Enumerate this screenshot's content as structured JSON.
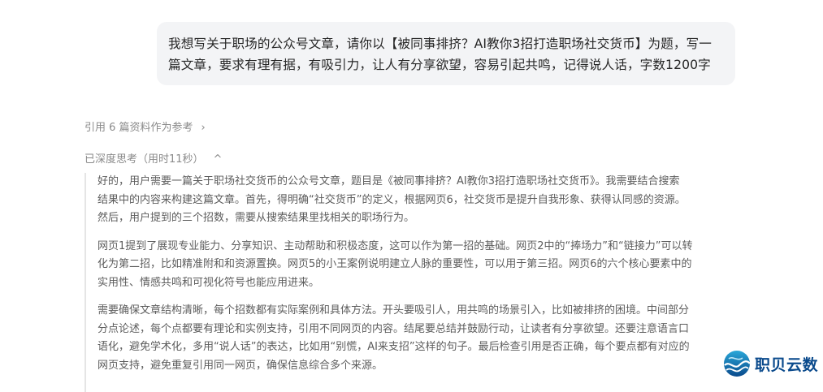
{
  "user_message": {
    "line1": "我想写关于职场的公众号文章，请你以【被同事排挤？AI教你3招打造职场社交货币】为题，写一",
    "line2": "篇文章，要求有理有据，有吸引力，让人有分享欲望，容易引起共鸣，记得说人话，字数1200字"
  },
  "references": {
    "label": "引用 6 篇资料作为参考",
    "chevron": "›"
  },
  "thinking": {
    "label": "已深度思考（用时11秒）",
    "chevron": "^",
    "paragraphs": [
      {
        "lines": [
          "好的，用户需要一篇关于职场社交货币的公众号文章，题目是《被同事排挤？AI教你3招打造职场社交货币》。我需要结合搜索",
          "结果中的内容来构建这篇文章。首先，得明确“社交货币”的定义，根据网页6，社交货币是提升自我形象、获得认同感的资源。",
          "然后，用户提到的三个招数，需要从搜索结果里找相关的职场行为。"
        ]
      },
      {
        "lines": [
          "网页1提到了展现专业能力、分享知识、主动帮助和积极态度，这可以作为第一招的基础。网页2中的“捧场力”和“链接力”可以转",
          "化为第二招，比如精准附和和资源置换。网页5的小王案例说明建立人脉的重要性，可以用于第三招。网页6的六个核心要素中的",
          "实用性、情感共鸣和可视化符号也能应用进来。"
        ]
      },
      {
        "lines": [
          "需要确保文章结构清晰，每个招数都有实际案例和具体方法。开头要吸引人，用共鸣的场景引入，比如被排挤的困境。中间部分",
          "分点论述，每个点都要有理论和实例支持，引用不同网页的内容。结尾要总结并鼓励行动，让读者有分享欲望。还要注意语言口",
          "语化，避免学术化，多用“说人话”的表达，比如用“别慌，AI来支招”这样的句子。最后检查引用是否正确，每个要点都有对应的",
          "网页支持，避免重复引用同一网页，确保信息综合多个来源。"
        ]
      }
    ]
  },
  "watermark": {
    "text": "职贝云数",
    "color": "#0a4a8c",
    "icon": "wave-globe-icon"
  }
}
